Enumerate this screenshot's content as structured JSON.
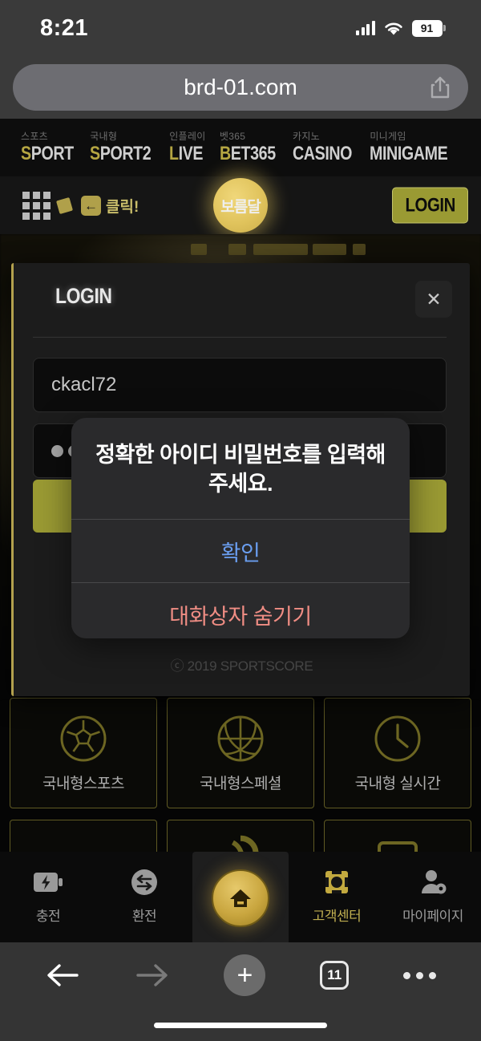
{
  "status_bar": {
    "time": "8:21",
    "battery_percent": "91",
    "signal_icon": "cellular-signal-icon",
    "wifi_icon": "wifi-icon",
    "battery_icon": "battery-icon"
  },
  "browser": {
    "url": "brd-01.com",
    "share_icon": "share-icon",
    "toolbar": {
      "back_icon": "back-arrow-icon",
      "forward_icon": "forward-arrow-icon",
      "new_tab_icon": "plus-icon",
      "tab_count": "11",
      "more_icon": "more-dots-icon"
    }
  },
  "site_nav": {
    "items": [
      {
        "ko": "스포츠",
        "en": "SPORT",
        "first": "S",
        "rest": "PORT"
      },
      {
        "ko": "국내형",
        "en": "SPORT2",
        "first": "S",
        "rest": "PORT2"
      },
      {
        "ko": "인플레이",
        "en": "LIVE",
        "first": "L",
        "rest": "IVE"
      },
      {
        "ko": "벳365",
        "en": "BET365",
        "first": "B",
        "rest": "ET365"
      },
      {
        "ko": "카지노",
        "en": "CASINO",
        "first": "",
        "rest": "CASINO"
      },
      {
        "ko": "미니게임",
        "en": "MINIGAME",
        "first": "",
        "rest": "MINIGAME"
      }
    ]
  },
  "site_header": {
    "grid_icon": "grid-menu-icon",
    "gold_square_icon": "gold-square-icon",
    "back_chip_icon": "back-chip-icon",
    "back_chip_glyph": "←",
    "click_text": "클릭!",
    "logo_text": "보름달",
    "login_label": "LOGIN"
  },
  "login_modal": {
    "title": "LOGIN",
    "close_icon": "close-icon",
    "close_glyph": "✕",
    "username_value": "ckacl72",
    "password_masked": "••",
    "copyright": "ⓒ 2019 SPORTSCORE"
  },
  "alert": {
    "message": "정확한 아이디 비밀번호를 입력해 주세요.",
    "confirm_label": "확인",
    "hide_label": "대화상자 숨기기"
  },
  "cards": [
    {
      "label": "국내형스포츠",
      "icon": "soccer-ball-icon"
    },
    {
      "label": "국내형스페셜",
      "icon": "basketball-icon"
    },
    {
      "label": "국내형 실시간",
      "icon": "clock-icon"
    }
  ],
  "tab_bar": {
    "items": [
      {
        "label": "충전",
        "icon": "battery-charge-icon",
        "active": false
      },
      {
        "label": "환전",
        "icon": "exchange-icon",
        "active": false
      },
      {
        "label": "",
        "icon": "home-icon",
        "active": true
      },
      {
        "label": "고객센터",
        "icon": "customer-service-icon",
        "active": false
      },
      {
        "label": "마이페이지",
        "icon": "my-page-icon",
        "active": false
      }
    ]
  },
  "colors": {
    "gold": "#b5a642",
    "olive_button": "#9a9a33",
    "alert_confirm_blue": "#6a9ef0",
    "alert_hide_red": "#f08d84",
    "modal_bg": "#1c1c1c"
  }
}
